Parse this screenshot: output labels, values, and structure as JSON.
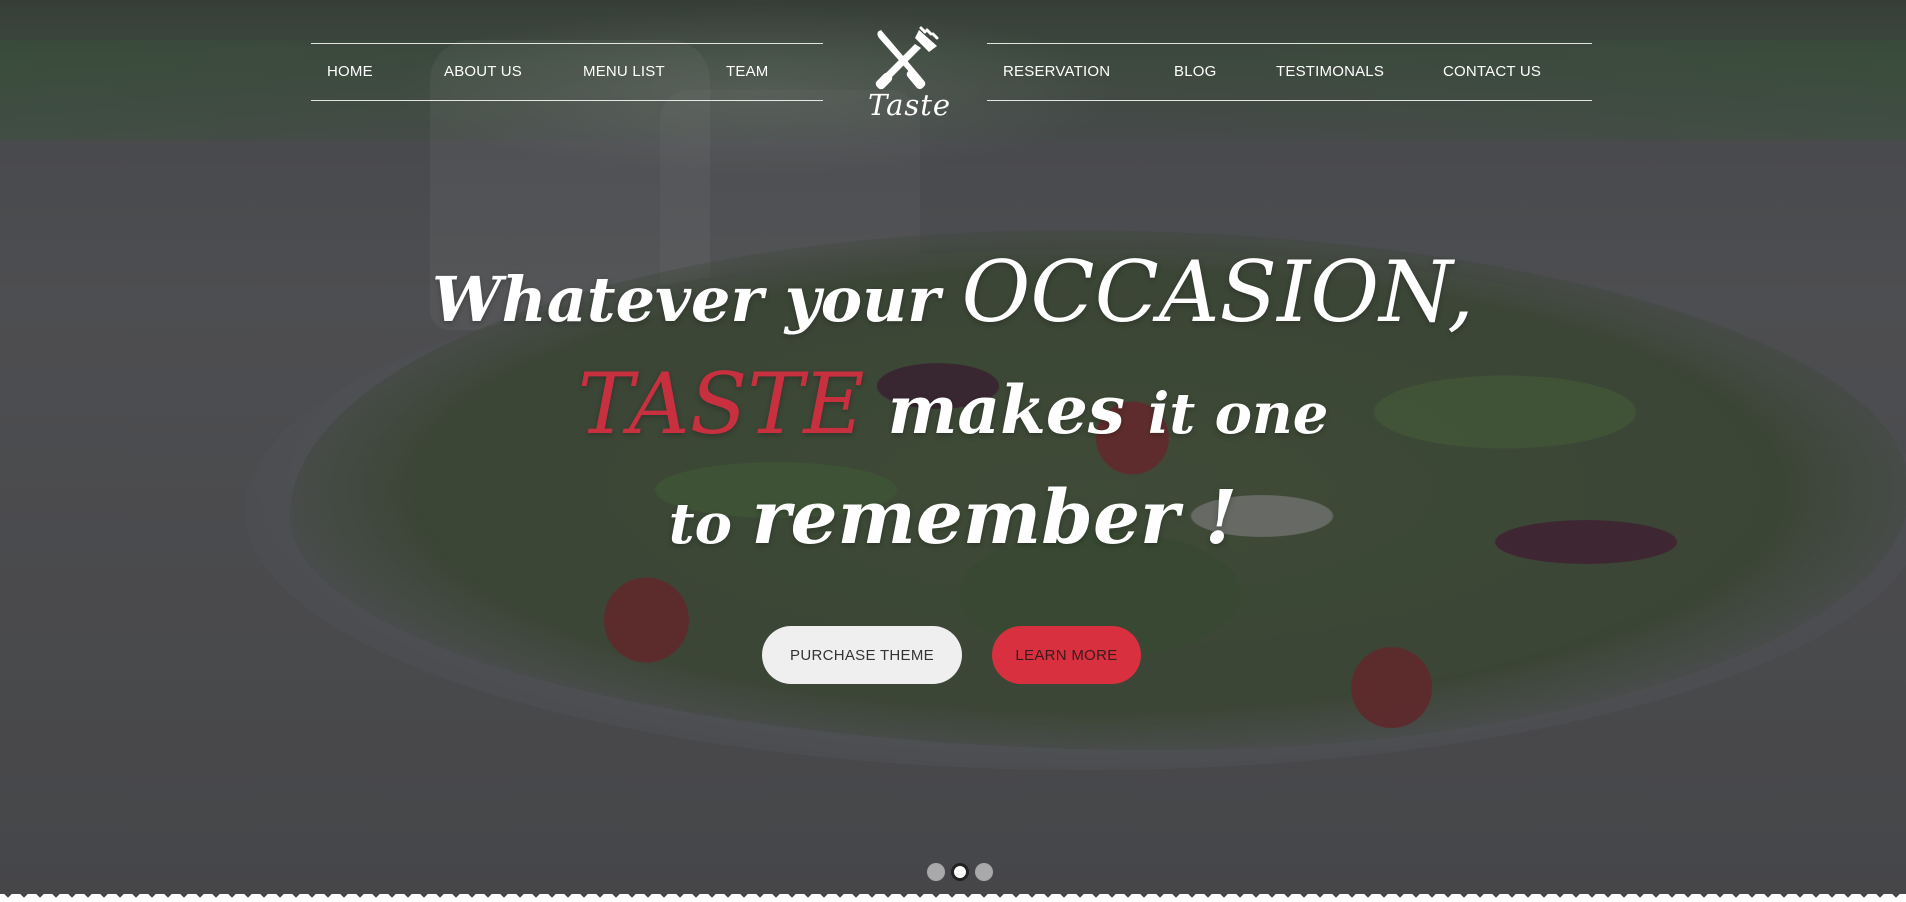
{
  "nav": {
    "left": [
      "HOME",
      "ABOUT US",
      "MENU LIST",
      "TEAM"
    ],
    "right": [
      "RESERVATION",
      "BLOG",
      "TESTIMONALS",
      "CONTACT US"
    ]
  },
  "logo": {
    "text": "Taste",
    "icon": "crossed-knife-fork-icon"
  },
  "hero": {
    "line1_pre": "Whatever your ",
    "line1_big": "OCCASION,",
    "line2_accent": "TASTE",
    "line2_mid": " makes ",
    "line2_end": "it one",
    "line3_pre": "to ",
    "line3_main": "remember !"
  },
  "buttons": {
    "purchase": "PURCHASE THEME",
    "learn": "LEARN MORE"
  },
  "slider": {
    "count": 3,
    "active_index": 1
  },
  "colors": {
    "accent": "#d8303f",
    "text": "#ffffff",
    "light_button": "#efefef"
  }
}
